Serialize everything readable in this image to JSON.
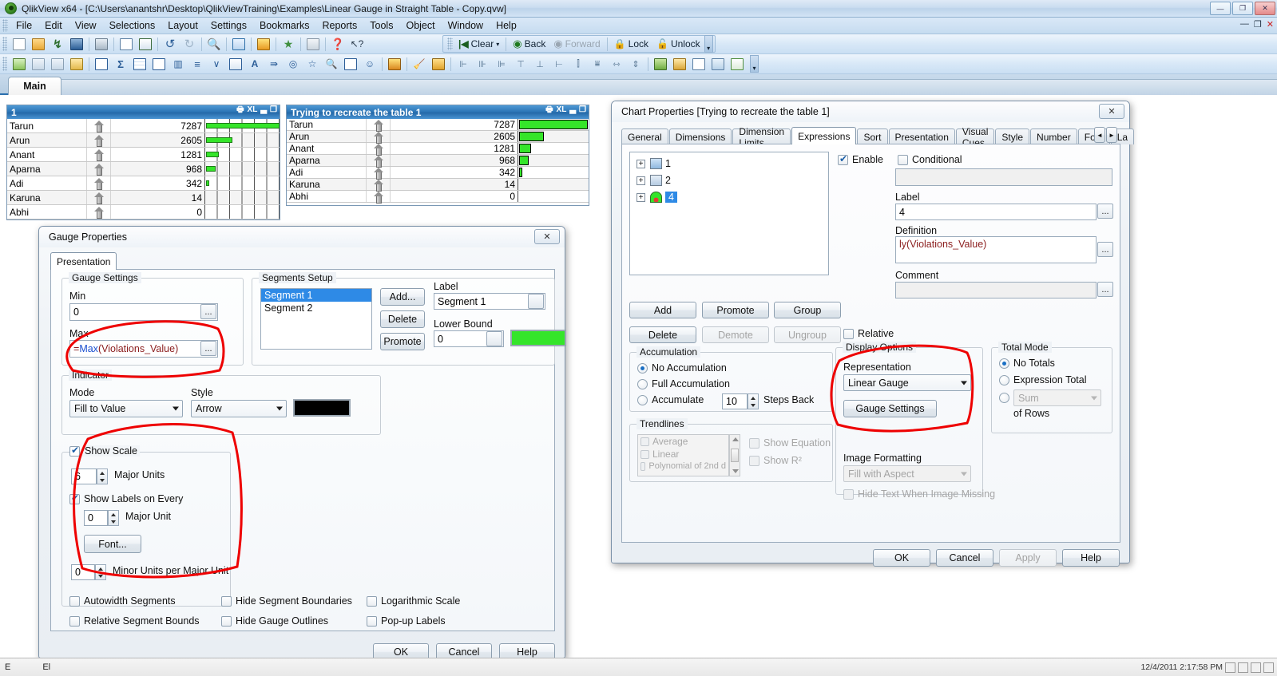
{
  "window": {
    "title": "QlikView x64 - [C:\\Users\\anantshr\\Desktop\\QlikViewTraining\\Examples\\Linear Gauge in Straight Table - Copy.qvw]",
    "ghost_text": "",
    "minimize": "—",
    "maximize": "❐",
    "close": "✕",
    "doc_minimize": "—",
    "doc_restore": "❐",
    "doc_close": "✕"
  },
  "menu": {
    "items": [
      "File",
      "Edit",
      "View",
      "Selections",
      "Layout",
      "Settings",
      "Bookmarks",
      "Reports",
      "Tools",
      "Object",
      "Window",
      "Help"
    ]
  },
  "toolbar_selection": {
    "clear": "Clear",
    "back": "Back",
    "forward": "Forward",
    "lock": "Lock",
    "unlock": "Unlock"
  },
  "sheet": {
    "tab_label": "Main"
  },
  "chart1": {
    "title": "1",
    "rows": [
      {
        "name": "Tarun",
        "value": "7287",
        "pct": 100
      },
      {
        "name": "Arun",
        "value": "2605",
        "pct": 35.7
      },
      {
        "name": "Anant",
        "value": "1281",
        "pct": 17.6
      },
      {
        "name": "Aparna",
        "value": "968",
        "pct": 13.3
      },
      {
        "name": "Adi",
        "value": "342",
        "pct": 4.7
      },
      {
        "name": "Karuna",
        "value": "14",
        "pct": 0.2
      },
      {
        "name": "Abhi",
        "value": "0",
        "pct": 0
      }
    ]
  },
  "chart2": {
    "title": "Trying to recreate the table 1",
    "rows": [
      {
        "name": "Tarun",
        "value": "7287",
        "pct": 100
      },
      {
        "name": "Arun",
        "value": "2605",
        "pct": 35.7
      },
      {
        "name": "Anant",
        "value": "1281",
        "pct": 17.6
      },
      {
        "name": "Aparna",
        "value": "968",
        "pct": 13.3
      },
      {
        "name": "Adi",
        "value": "342",
        "pct": 4.7
      },
      {
        "name": "Karuna",
        "value": "14",
        "pct": 0.2
      },
      {
        "name": "Abhi",
        "value": "0",
        "pct": 0
      }
    ]
  },
  "gauge_dialog": {
    "title": "Gauge Properties",
    "close": "✕",
    "tab": "Presentation",
    "gauge_settings": {
      "legend": "Gauge Settings",
      "min_label": "Min",
      "min_value": "0",
      "max_label": "Max",
      "max_value_prefix": "=",
      "max_value_fn": "Max",
      "max_value_arg": "(Violations_Value)",
      "ellipsis": "..."
    },
    "segments": {
      "legend": "Segments Setup",
      "items": [
        "Segment 1",
        "Segment 2"
      ],
      "selected_index": 0,
      "add": "Add...",
      "delete": "Delete",
      "promote": "Promote",
      "label_caption": "Label",
      "label_value": "Segment 1",
      "lower_bound_caption": "Lower Bound",
      "lower_bound_value": "0",
      "segment_color": "#35e52a"
    },
    "indicator": {
      "legend": "Indicator",
      "mode_caption": "Mode",
      "mode_value": "Fill to Value",
      "style_caption": "Style",
      "style_value": "Arrow",
      "indicator_color": "#000000"
    },
    "scale": {
      "show_scale_label": "Show Scale",
      "show_scale_checked": true,
      "major_units_value": "6",
      "major_units_label": "Major Units",
      "show_labels_every_label": "Show Labels on Every",
      "show_labels_every_checked": true,
      "major_unit_value": "0",
      "major_unit_label": "Major Unit",
      "font_button": "Font...",
      "minor_units_value": "0",
      "minor_units_label": "Minor Units per Major Unit"
    },
    "checks": [
      {
        "label": "Autowidth Segments",
        "checked": false
      },
      {
        "label": "Hide Segment Boundaries",
        "checked": false
      },
      {
        "label": "Logarithmic Scale",
        "checked": false
      },
      {
        "label": "Relative Segment Bounds",
        "checked": false
      },
      {
        "label": "Hide Gauge Outlines",
        "checked": false
      },
      {
        "label": "Pop-up Labels",
        "checked": false
      }
    ],
    "buttons": {
      "ok": "OK",
      "cancel": "Cancel",
      "help": "Help"
    }
  },
  "chart_dialog": {
    "title": "Chart Properties [Trying to recreate the table 1]",
    "close": "✕",
    "tabs": [
      "General",
      "Dimensions",
      "Dimension Limits",
      "Expressions",
      "Sort",
      "Presentation",
      "Visual Cues",
      "Style",
      "Number",
      "Font",
      "La"
    ],
    "active_tab": "Expressions",
    "nav_prev": "◄",
    "nav_next": "►",
    "expressions": [
      {
        "label": "1",
        "icon": "image-icon",
        "selected": false
      },
      {
        "label": "2",
        "icon": "table-icon",
        "selected": false
      },
      {
        "label": "4",
        "icon": "gauge-icon",
        "selected": true
      }
    ],
    "enable_label": "Enable",
    "enable_checked": true,
    "conditional_label": "Conditional",
    "conditional_checked": false,
    "conditional_value": "",
    "label_caption": "Label",
    "label_value": "4",
    "definition_caption": "Definition",
    "definition_value": "ly(Violations_Value)",
    "comment_caption": "Comment",
    "comment_value": "",
    "ellipsis": "...",
    "buttons_row": {
      "add": "Add",
      "promote": "Promote",
      "group": "Group",
      "delete": "Delete",
      "demote": "Demote",
      "ungroup": "Ungroup"
    },
    "relative_label": "Relative",
    "relative_checked": false,
    "accumulation": {
      "legend": "Accumulation",
      "no_accumulation": "No Accumulation",
      "full_accumulation": "Full Accumulation",
      "accumulate": "Accumulate",
      "steps_value": "10",
      "steps_label": "Steps Back",
      "selected": "no_accumulation"
    },
    "trendlines": {
      "legend": "Trendlines",
      "items": [
        "Average",
        "Linear",
        "Polynomial of 2nd d"
      ],
      "show_equation": "Show Equation",
      "show_r2": "Show R²"
    },
    "display_options": {
      "legend": "Display Options",
      "representation_caption": "Representation",
      "representation_value": "Linear Gauge",
      "gauge_settings_button": "Gauge Settings",
      "image_formatting_caption": "Image Formatting",
      "image_formatting_value": "Fill with Aspect",
      "hide_text_label": "Hide Text When Image Missing",
      "hide_text_checked": false
    },
    "total_mode": {
      "legend": "Total Mode",
      "no_totals": "No Totals",
      "expression_total": "Expression Total",
      "sum_value": "Sum",
      "of_rows": "of Rows",
      "selected": "no_totals"
    },
    "buttons": {
      "ok": "OK",
      "cancel": "Cancel",
      "apply": "Apply",
      "help": "Help"
    }
  },
  "status": {
    "left": "E",
    "selection": "El",
    "datetime": "12/4/2011 2:17:58 PM"
  },
  "colors": {
    "accent": "#2e77b8",
    "gauge_green": "#35e52a",
    "annotation_red": "#ee0000",
    "selection_blue": "#2e8ae6"
  }
}
